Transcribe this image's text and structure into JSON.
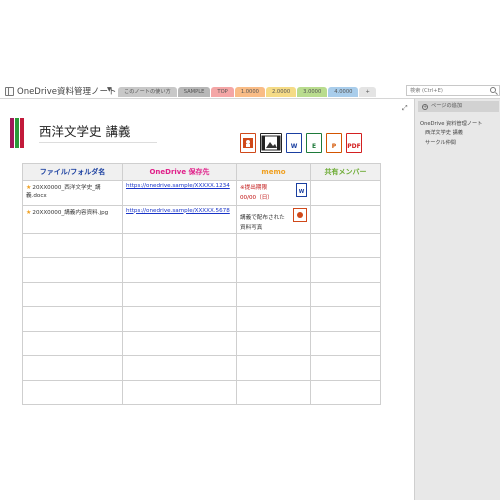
{
  "notebook": {
    "title": "OneDrive資料管理ノート",
    "caret": "▼"
  },
  "tabs": [
    {
      "label": "このノートの使い方",
      "color": "#c8c8c8"
    },
    {
      "label": "SAMPLE",
      "color": "#b7b7b7"
    },
    {
      "label": "TOP",
      "color": "#f4a6a6"
    },
    {
      "label": "1.0000",
      "color": "#f9bc86"
    },
    {
      "label": "2.0000",
      "color": "#f5db86"
    },
    {
      "label": "3.0000",
      "color": "#b9dc8e"
    },
    {
      "label": "4.0000",
      "color": "#a9cdeb"
    },
    {
      "label": "+",
      "color": "#e4e4e4"
    }
  ],
  "search": {
    "placeholder": "検索 (Ctrl+E)"
  },
  "right_panel": {
    "add_page": "ページの追加",
    "pages": [
      "OneDrive 資料管理ノート",
      "西洋文学史 講義",
      "サークル仲間"
    ]
  },
  "page": {
    "title": "西洋文学史 講義",
    "file_icons": [
      {
        "name": "image",
        "label": "",
        "color": "#d0491a"
      },
      {
        "name": "video",
        "label": "",
        "color": "#222222"
      },
      {
        "name": "word",
        "label": "W",
        "color": "#1a3fa0"
      },
      {
        "name": "excel",
        "label": "E",
        "color": "#1e7a3a"
      },
      {
        "name": "powerpoint",
        "label": "P",
        "color": "#d35400"
      },
      {
        "name": "pdf",
        "label": "PDF",
        "color": "#d32020"
      }
    ],
    "table": {
      "headers": [
        {
          "label": "ファイル/フォルダ名",
          "color": "#1a3fa0"
        },
        {
          "label": "OneDrive 保存先",
          "color": "#e0218a"
        },
        {
          "label": "memo",
          "color": "#f0a020"
        },
        {
          "label": "共有メンバー",
          "color": "#6aaa30"
        }
      ],
      "rows": [
        {
          "name": "20XX0000_西洋文学史_講義.docx",
          "link": "https://onedrive.sample/XXXXX.1234",
          "memo1": "※提出期限",
          "memo2": "00/00（日）",
          "memo_icon": "W"
        },
        {
          "name": "20XX0000_講義内容資料.jpg",
          "link": "https://onedrive.sample/XXXXX.5678",
          "memo1": "講義で配布された",
          "memo2": "資料写真",
          "memo_icon": "image"
        }
      ]
    }
  }
}
